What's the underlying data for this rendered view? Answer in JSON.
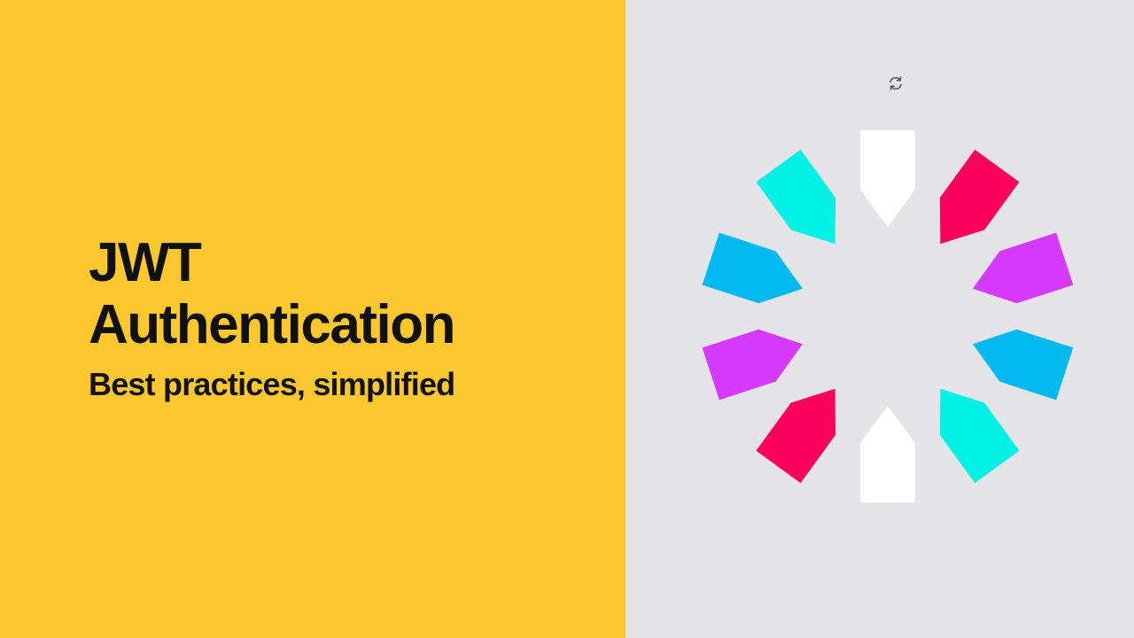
{
  "headline": {
    "line1": "JWT",
    "line2": "Authentication"
  },
  "subtitle": "Best practices, simplified",
  "colors": {
    "left_background": "#FDC82D",
    "right_background": "#E4E3E7",
    "text": "#111111",
    "logo_white": "#FFFFFF",
    "logo_red": "#FB015B",
    "logo_purple": "#D63AFF",
    "logo_blue": "#00B9F1",
    "logo_cyan": "#00F2E6"
  },
  "icons": {
    "refresh": "refresh-icon",
    "logo": "jwt-logo-icon"
  }
}
